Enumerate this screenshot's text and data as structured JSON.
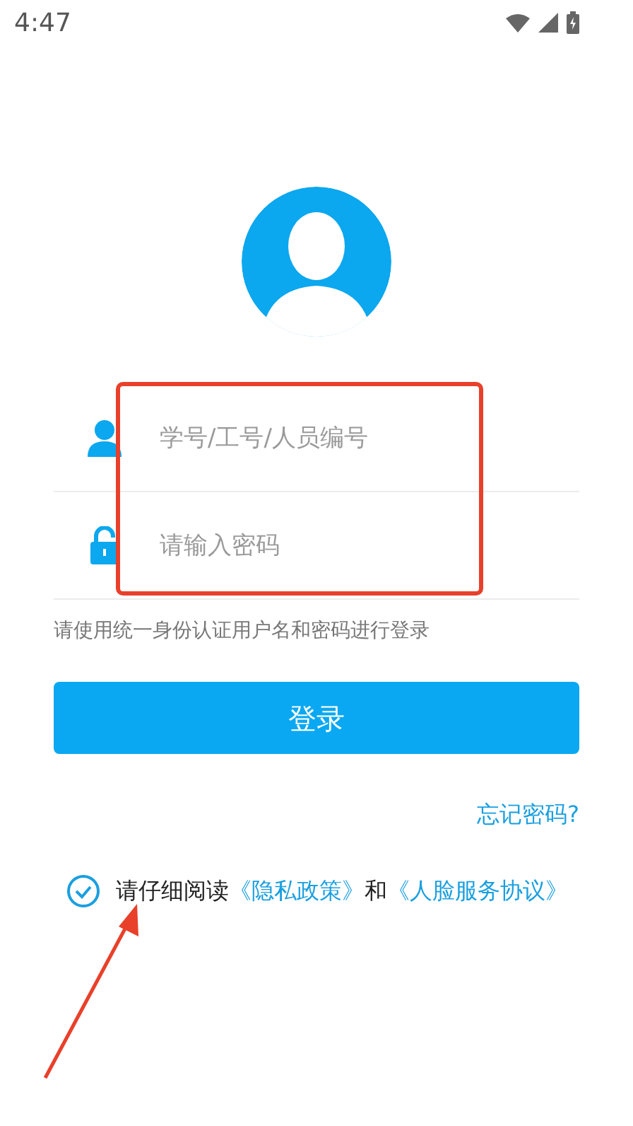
{
  "status_bar": {
    "time": "4:47"
  },
  "login_form": {
    "fields": [
      {
        "kind": "account",
        "placeholder": "学号/工号/人员编号"
      },
      {
        "kind": "password",
        "placeholder": "请输入密码"
      }
    ],
    "hint": "请使用统一身份认证用户名和密码进行登录",
    "login_button": "登录",
    "forgot_password": "忘记密码?"
  },
  "agreement": {
    "checked": true,
    "text": "请仔细阅读",
    "link_1": "《隐私政策》",
    "conjunction": "和",
    "link_2": "《人脸服务协议》"
  },
  "annotation": {
    "highlight": true,
    "arrow": true
  }
}
